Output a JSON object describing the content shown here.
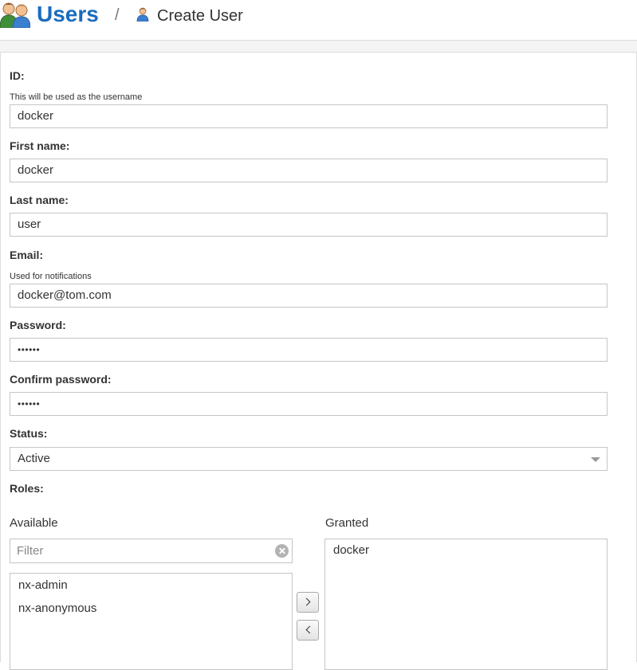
{
  "header": {
    "title": "Users",
    "separator": "/",
    "subtitle": "Create User"
  },
  "form": {
    "id": {
      "label": "ID:",
      "hint": "This will be used as the username",
      "value": "docker"
    },
    "first_name": {
      "label": "First name:",
      "value": "docker"
    },
    "last_name": {
      "label": "Last name:",
      "value": "user"
    },
    "email": {
      "label": "Email:",
      "hint": "Used for notifications",
      "value": "docker@tom.com"
    },
    "password": {
      "label": "Password:",
      "masked_value": "••••••"
    },
    "confirm_password": {
      "label": "Confirm password:",
      "masked_value": "••••••"
    },
    "status": {
      "label": "Status:",
      "selected": "Active"
    },
    "roles": {
      "label": "Roles:",
      "available_title": "Available",
      "granted_title": "Granted",
      "filter_placeholder": "Filter",
      "available": [
        "nx-admin",
        "nx-anonymous"
      ],
      "granted": [
        "docker"
      ]
    }
  },
  "icons": {
    "users": "users-icon",
    "user": "user-icon",
    "clear": "clear-filter-icon",
    "move_right": "chevron-right-icon",
    "move_left": "chevron-left-icon",
    "dropdown": "dropdown-arrow-icon"
  },
  "colors": {
    "title_blue": "#1a6cbf",
    "border": "#c5c5c5",
    "text": "#333333"
  }
}
